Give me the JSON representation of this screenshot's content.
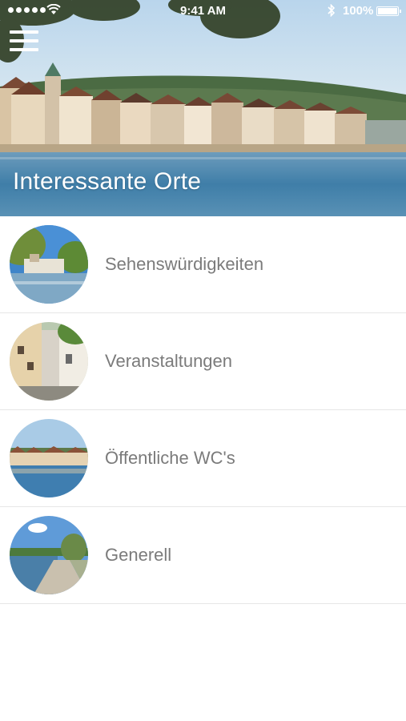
{
  "status_bar": {
    "time": "9:41 AM",
    "battery": "100%",
    "icons": [
      "signal-dots-icon",
      "wifi-icon",
      "bluetooth-icon",
      "battery-icon"
    ]
  },
  "header": {
    "title": "Interessante Orte",
    "menu_icon": "hamburger-menu-icon"
  },
  "list": {
    "items": [
      {
        "label": "Sehenswürdigkeiten"
      },
      {
        "label": "Veranstaltungen"
      },
      {
        "label": "Öffentliche WC's"
      },
      {
        "label": "Generell"
      }
    ]
  },
  "colors": {
    "label_text": "#7b7b7b",
    "divider": "#e6e6e6",
    "background": "#ffffff"
  }
}
